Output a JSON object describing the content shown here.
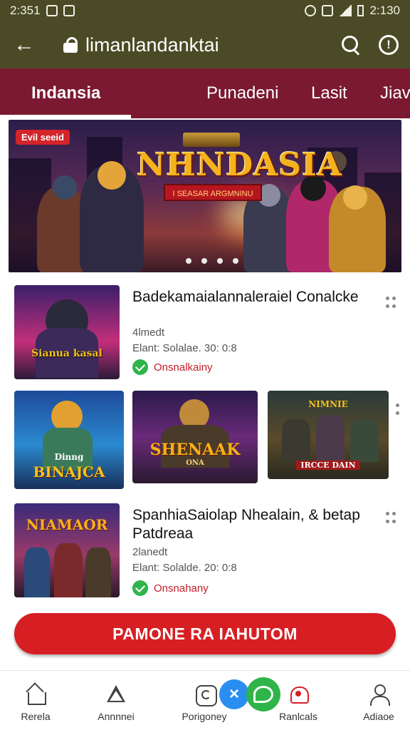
{
  "status_bar": {
    "time": "2:351",
    "right_time": "2:130"
  },
  "url_bar": {
    "url": "limanlandanktai",
    "icons": [
      "back-arrow-icon",
      "lock-icon",
      "search-icon",
      "info-icon"
    ]
  },
  "tabs": [
    {
      "label": "Indansia",
      "active": true
    },
    {
      "label": "Punadeni",
      "active": false
    },
    {
      "label": "Lasit",
      "active": false
    },
    {
      "label": "Jiav",
      "active": false
    }
  ],
  "banner": {
    "badge": "Evil seeid",
    "title": "NHNDASIA",
    "subtitle": "I SEASAR ARGMNINU",
    "slides": 4,
    "active_slide": 0
  },
  "items": [
    {
      "title": "Badekamaialannaleraiel Conalcke",
      "meta1": "4lmedt",
      "meta2": "Elant: Solalae.  30: 0:8",
      "status": "Onsnalkainy",
      "thumb_label": "Sianua kasal"
    },
    {
      "title": "SpanhiaSaiolap Nhealain, & betap Patdreaa",
      "meta1": "2lanedt",
      "meta2": "Elant: Solalde.  20: 0:8",
      "status": "Onsnahany",
      "thumb_label": "NIAMAOR"
    }
  ],
  "row_thumbs": [
    {
      "label": "BINAJCA",
      "sublabel": "Dinng"
    },
    {
      "label": "SHENAAK",
      "sublabel": "ONA"
    },
    {
      "label": "IRCCE DAIN",
      "sublabel": "NIMNIE"
    }
  ],
  "cta": {
    "label": "PAMONE RA IAHUTOM"
  },
  "bottom_nav": [
    {
      "label": "Rerela",
      "icon": "home-icon"
    },
    {
      "label": "Annnnei",
      "icon": "triangle-icon"
    },
    {
      "label": "Porigoney",
      "icon": "app-icon"
    },
    {
      "label": "Ranlcals",
      "icon": "bell-icon"
    },
    {
      "label": "Adiaoe",
      "icon": "user-icon"
    }
  ],
  "fabs": {
    "close_label": "×"
  },
  "colors": {
    "topbar": "#4a4a26",
    "tabbar": "#7b1930",
    "accent": "#d71f23",
    "status_green": "#2fb44a"
  }
}
